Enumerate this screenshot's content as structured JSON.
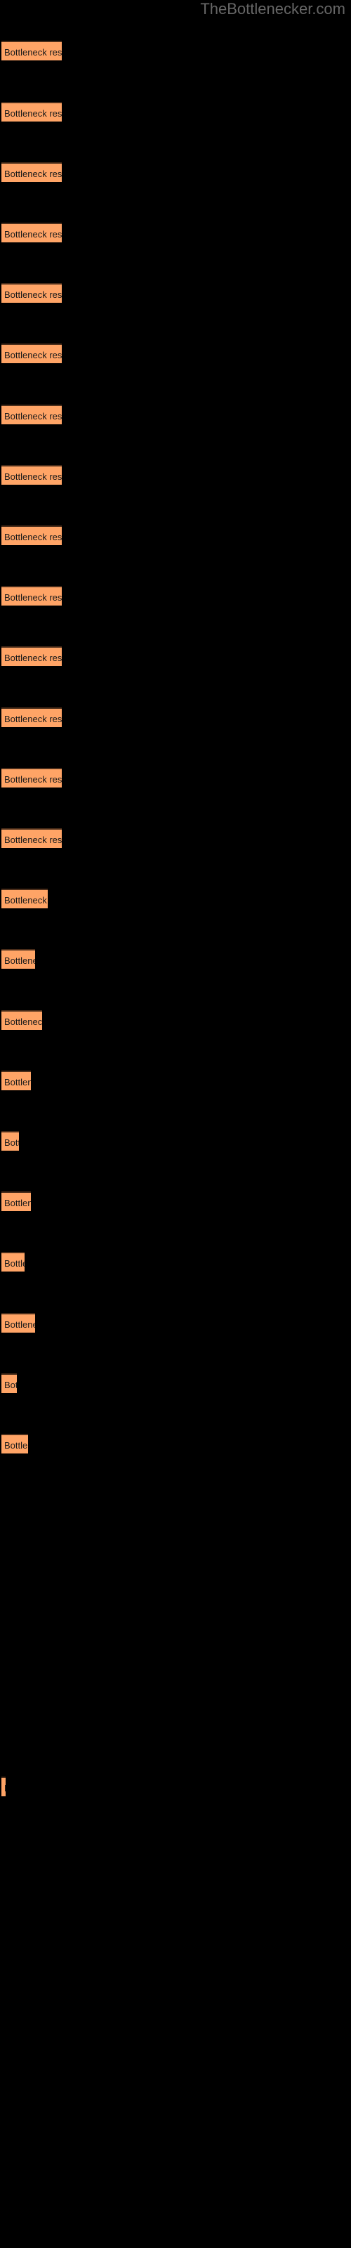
{
  "watermark": {
    "text": "TheBottlenecker.com",
    "color": "#666666"
  },
  "colors": {
    "background": "#000000",
    "bar_fill": "#ffa466",
    "bar_edge": "#4a2d1a",
    "label_text": "#1a1a1a",
    "watermark_text": "#666666"
  },
  "chart_data": {
    "type": "bar",
    "orientation": "horizontal",
    "title": "",
    "subtitle": "",
    "xlabel": "",
    "ylabel": "",
    "grid": false,
    "legend": null,
    "axis_visible": false,
    "tick_labels_visible": false,
    "bar_label_text": "Bottleneck result",
    "categories": [
      "Bottleneck result",
      "Bottleneck result",
      "Bottleneck result",
      "Bottleneck result",
      "Bottleneck result",
      "Bottleneck result",
      "Bottleneck result",
      "Bottleneck result",
      "Bottleneck result",
      "Bottleneck result",
      "Bottleneck result",
      "Bottleneck result",
      "Bottleneck result",
      "Bottleneck result",
      "Bottleneck result",
      "Bottleneck result",
      "Bottleneck result",
      "Bottleneck result",
      "Bottleneck result",
      "Bottleneck result",
      "Bottleneck result",
      "Bottleneck result",
      "Bottleneck result",
      "Bottleneck result"
    ],
    "values": [
      86,
      86,
      86,
      86,
      86,
      86,
      86,
      86,
      86,
      86,
      86,
      86,
      86,
      86,
      62,
      46,
      56,
      41,
      25,
      41,
      33,
      47,
      22,
      38,
      5
    ],
    "xlim": [
      0,
      500
    ],
    "bars": [
      {
        "index": 1,
        "y": 58,
        "width": 86,
        "label": "Bottleneck result"
      },
      {
        "index": 2,
        "y": 145,
        "width": 86,
        "label": "Bottleneck result"
      },
      {
        "index": 3,
        "y": 231,
        "width": 86,
        "label": "Bottleneck result"
      },
      {
        "index": 4,
        "y": 317,
        "width": 86,
        "label": "Bottleneck result"
      },
      {
        "index": 5,
        "y": 403,
        "width": 86,
        "label": "Bottleneck result"
      },
      {
        "index": 6,
        "y": 489,
        "width": 86,
        "label": "Bottleneck result"
      },
      {
        "index": 7,
        "y": 576,
        "width": 86,
        "label": "Bottleneck result"
      },
      {
        "index": 8,
        "y": 662,
        "width": 86,
        "label": "Bottleneck result"
      },
      {
        "index": 9,
        "y": 748,
        "width": 86,
        "label": "Bottleneck result"
      },
      {
        "index": 10,
        "y": 834,
        "width": 86,
        "label": "Bottleneck result"
      },
      {
        "index": 11,
        "y": 920,
        "width": 86,
        "label": "Bottleneck result"
      },
      {
        "index": 12,
        "y": 1007,
        "width": 86,
        "label": "Bottleneck result"
      },
      {
        "index": 13,
        "y": 1093,
        "width": 86,
        "label": "Bottleneck result"
      },
      {
        "index": 14,
        "y": 1179,
        "width": 86,
        "label": "Bottleneck result"
      },
      {
        "index": 15,
        "y": 1265,
        "width": 66,
        "label": "Bottleneck result"
      },
      {
        "index": 16,
        "y": 1351,
        "width": 48,
        "label": "Bottleneck result"
      },
      {
        "index": 17,
        "y": 1438,
        "width": 58,
        "label": "Bottleneck result"
      },
      {
        "index": 18,
        "y": 1524,
        "width": 42,
        "label": "Bottleneck result"
      },
      {
        "index": 19,
        "y": 1610,
        "width": 25,
        "label": "Bottleneck result"
      },
      {
        "index": 20,
        "y": 1696,
        "width": 42,
        "label": "Bottleneck result"
      },
      {
        "index": 21,
        "y": 1782,
        "width": 33,
        "label": "Bottleneck result"
      },
      {
        "index": 22,
        "y": 1869,
        "width": 48,
        "label": "Bottleneck result"
      },
      {
        "index": 23,
        "y": 1955,
        "width": 22,
        "label": "Bottleneck result"
      },
      {
        "index": 24,
        "y": 2041,
        "width": 38,
        "label": "Bottleneck result"
      },
      {
        "index": 25,
        "y": 2529,
        "width": 6,
        "label": "Bottleneck result"
      }
    ]
  }
}
